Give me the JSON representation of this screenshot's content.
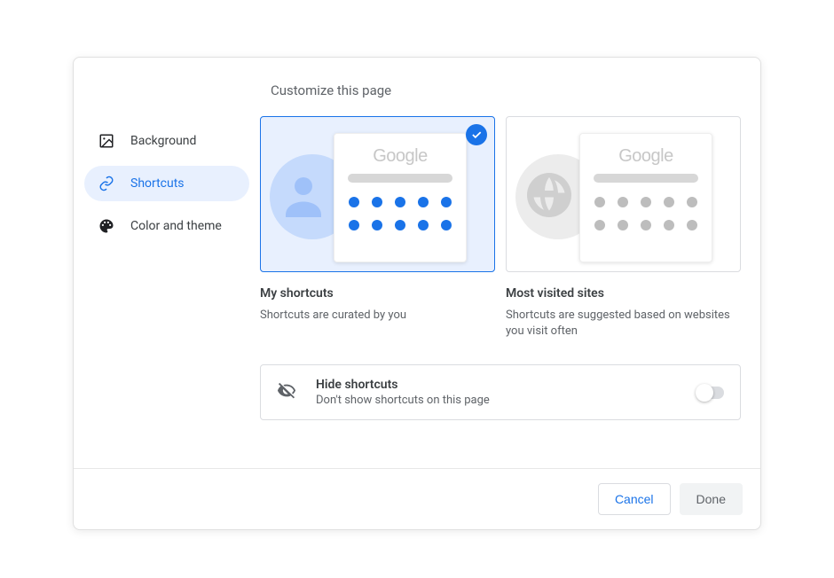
{
  "dialog": {
    "title": "Customize this page"
  },
  "sidebar": {
    "items": [
      {
        "label": "Background",
        "icon": "image-icon"
      },
      {
        "label": "Shortcuts",
        "icon": "link-icon"
      },
      {
        "label": "Color and theme",
        "icon": "palette-icon"
      }
    ]
  },
  "options": {
    "my_shortcuts": {
      "title": "My shortcuts",
      "description": "Shortcuts are curated by you",
      "selected": true,
      "preview_logo": "Google"
    },
    "most_visited": {
      "title": "Most visited sites",
      "description": "Shortcuts are suggested based on websites you visit often",
      "selected": false,
      "preview_logo": "Google"
    }
  },
  "hide": {
    "title": "Hide shortcuts",
    "description": "Don't show shortcuts on this page",
    "enabled": false
  },
  "buttons": {
    "cancel": "Cancel",
    "done": "Done"
  },
  "colors": {
    "accent": "#1a73e8",
    "selected_bg": "#e8f0fe"
  }
}
